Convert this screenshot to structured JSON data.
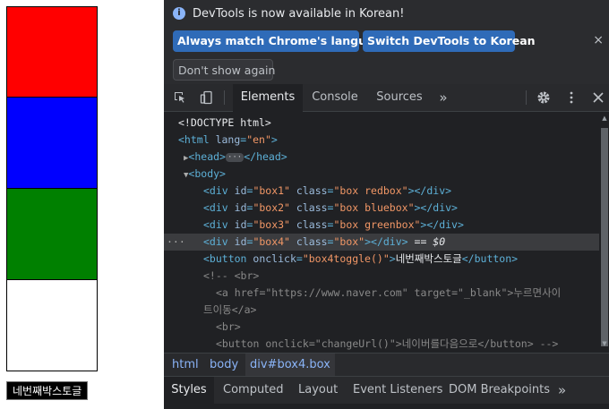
{
  "page": {
    "boxes": [
      {
        "id": "box1",
        "color": "#ff0000"
      },
      {
        "id": "box2",
        "color": "#0000ff"
      },
      {
        "id": "box3",
        "color": "#008000"
      },
      {
        "id": "box4",
        "color": "#ffffff"
      }
    ],
    "toggle_button_label": "네번째박스토글"
  },
  "devtools": {
    "banner": {
      "message": "DevTools is now available in Korean!",
      "match_button": "Always match Chrome's language",
      "switch_button": "Switch DevTools to Korean",
      "dont_show_button": "Don't show again",
      "close_glyph": "×"
    },
    "tabs": [
      "Elements",
      "Console",
      "Sources"
    ],
    "active_tab": "Elements",
    "more_tabs_glyph": "»",
    "code_lines": [
      {
        "html": "<span class='p'>&lt;!DOCTYPE html&gt;</span>"
      },
      {
        "html": "<span class='t'>&lt;html</span> <span class='a'>lang</span><span class='t'>=</span><span class='v'>\"en\"</span><span class='t'>&gt;</span>"
      },
      {
        "html": "<span class='tri'>▶</span><span class='t'>&lt;head&gt;</span><span class='ellipsis'>···</span><span class='t'>&lt;/head&gt;</span>"
      },
      {
        "html": "<span class='tri'>▼</span><span class='t'>&lt;body&gt;</span>"
      },
      {
        "html": "<span class='t'>&lt;div</span> <span class='a'>id</span><span class='t'>=</span><span class='v'>\"box1\"</span> <span class='a'>class</span><span class='t'>=</span><span class='v'>\"box redbox\"</span><span class='t'>&gt;&lt;/div&gt;</span>"
      },
      {
        "html": "<span class='t'>&lt;div</span> <span class='a'>id</span><span class='t'>=</span><span class='v'>\"box2\"</span> <span class='a'>class</span><span class='t'>=</span><span class='v'>\"box bluebox\"</span><span class='t'>&gt;&lt;/div&gt;</span>"
      },
      {
        "html": "<span class='t'>&lt;div</span> <span class='a'>id</span><span class='t'>=</span><span class='v'>\"box3\"</span> <span class='a'>class</span><span class='t'>=</span><span class='v'>\"box greenbox\"</span><span class='t'>&gt;&lt;/div&gt;</span>"
      },
      {
        "html": "<span class='t'>&lt;div</span> <span class='a'>id</span><span class='t'>=</span><span class='v'>\"box4\"</span> <span class='a'>class</span><span class='t'>=</span><span class='v'>\"box\"</span><span class='t'>&gt;&lt;/div&gt;</span> <span class='p'>== </span><span class='p' style='font-style:italic'>$0</span>"
      },
      {
        "html": "<span class='t'>&lt;button</span> <span class='a'>onclick</span><span class='t'>=</span><span class='v'>\"box4toggle()\"</span><span class='t'>&gt;</span><span class='p'>네번째박스토글</span><span class='t'>&lt;/button&gt;</span>"
      },
      {
        "html": "<span class='c'>&lt;!-- &lt;br&gt;</span>"
      },
      {
        "html": "<span class='c'>&lt;a href=\"https://www.naver.com\" target=\"_blank\"&gt;누르면사이</span>"
      },
      {
        "html": "<span class='c'>트이동&lt;/a&gt;</span>"
      },
      {
        "html": "<span class='c'>&lt;br&gt;</span>"
      },
      {
        "html": "<span class='c'>&lt;button onclick=\"changeUrl()\"&gt;네이버를다음으로&lt;/button&gt; --&gt;</span>"
      }
    ],
    "breadcrumbs": [
      "html",
      "body",
      "div#box4.box"
    ],
    "subtabs": [
      "Styles",
      "Computed",
      "Layout",
      "Event Listeners",
      "DOM Breakpoints"
    ],
    "active_subtab": "Styles"
  }
}
